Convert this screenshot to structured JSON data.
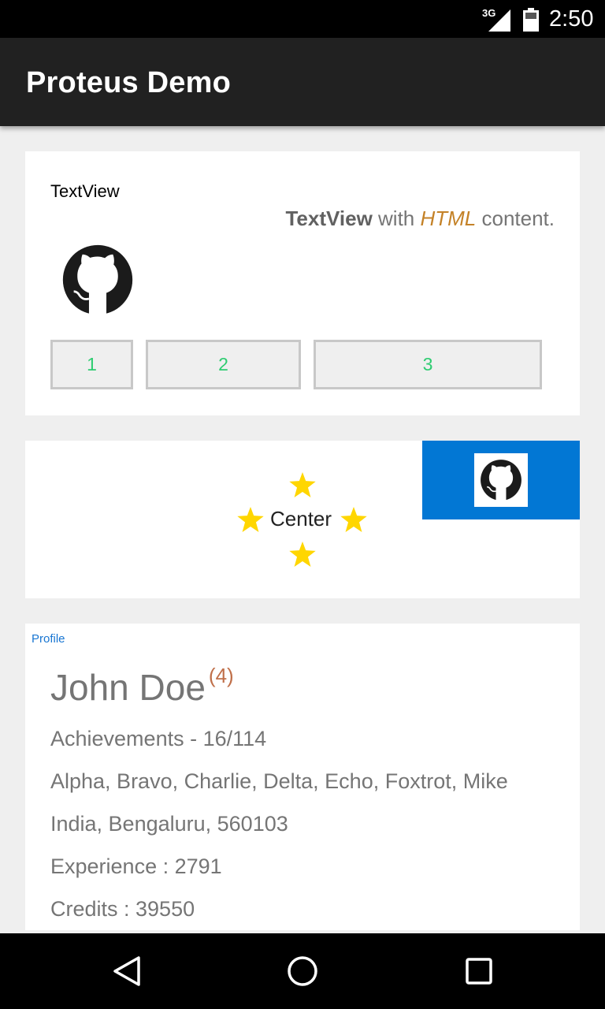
{
  "status_bar": {
    "network": "3G",
    "time": "2:50",
    "icons": [
      "signal-icon",
      "battery-icon"
    ]
  },
  "app_bar": {
    "title": "Proteus Demo"
  },
  "card1": {
    "label": "TextView",
    "html_bold": "TextView",
    "html_with": " with ",
    "html_italic": "HTML",
    "html_rest": " content.",
    "icon": "github-icon",
    "buttons": [
      "1",
      "2",
      "3"
    ]
  },
  "card2": {
    "center_label": "Center",
    "icons": [
      "star-icon",
      "github-icon"
    ]
  },
  "profile": {
    "label": "Profile",
    "name": "John Doe",
    "count": "(4)",
    "achievements": "Achievements - 16/114",
    "tags": "Alpha, Bravo, Charlie, Delta, Echo, Foxtrot, Mike",
    "location": "India, Bengaluru, 560103",
    "experience": "Experience : 2791",
    "credits": "Credits : 39550"
  },
  "nav_bar": {
    "icons": [
      "back-icon",
      "home-icon",
      "recents-icon"
    ]
  },
  "colors": {
    "accent_blue": "#0277d4",
    "button_text": "#2ecc71",
    "html_italic": "#c48228",
    "star": "#ffd600"
  }
}
